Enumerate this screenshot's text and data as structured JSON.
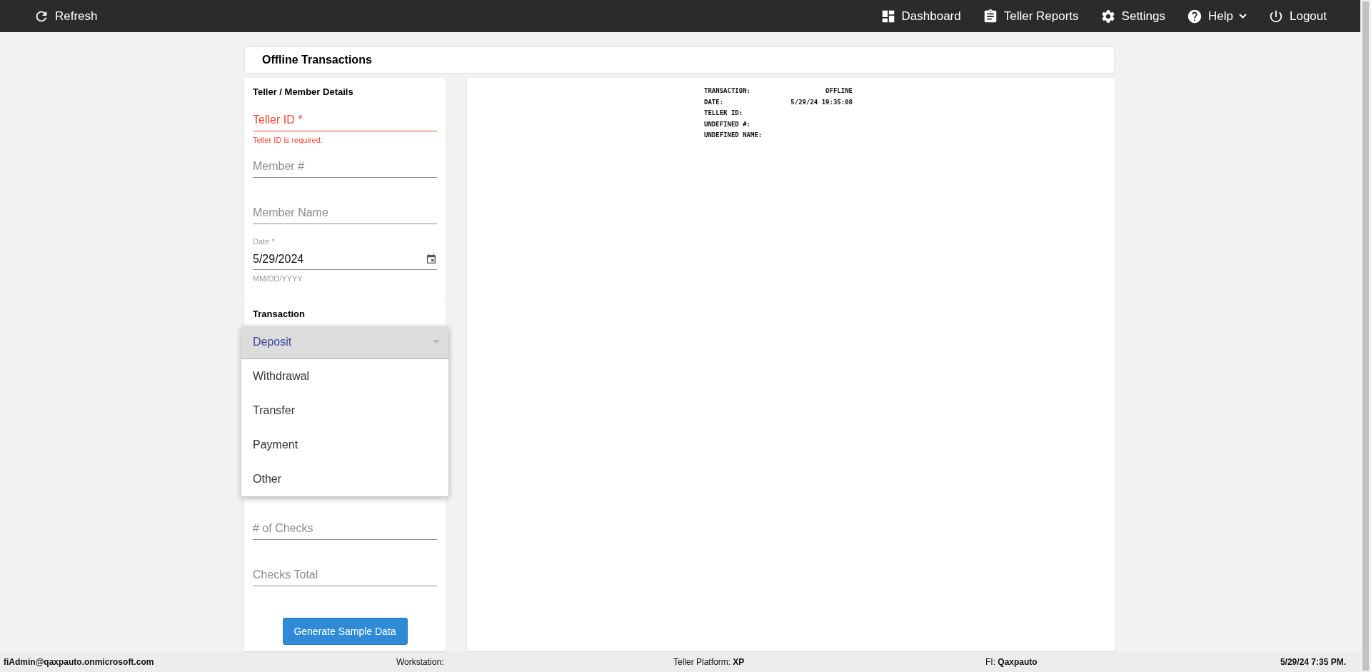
{
  "nav": {
    "left": [
      {
        "kind": "refresh",
        "label": "Refresh"
      }
    ],
    "right": [
      {
        "kind": "dashboard",
        "label": "Dashboard",
        "menu": false
      },
      {
        "kind": "clipboard",
        "label": "Teller Reports",
        "menu": false
      },
      {
        "kind": "gear",
        "label": "Settings",
        "menu": false
      },
      {
        "kind": "help",
        "label": "Help",
        "menu": true
      },
      {
        "kind": "power",
        "label": "Logout",
        "menu": false
      }
    ]
  },
  "page_title": "Offline Transactions",
  "details_card": {
    "title": "Teller / Member Details",
    "fields": [
      {
        "placeholder": "Teller ID *",
        "error": "Teller ID is required.",
        "invalid": true
      },
      {
        "placeholder": "Member #",
        "invalid": false
      },
      {
        "placeholder": "Member Name",
        "invalid": false
      }
    ],
    "date": {
      "label": "Date *",
      "value": "5/29/2024",
      "hint": "MM/DD/YYYY"
    }
  },
  "transaction_card": {
    "title": "Transaction",
    "type_menu": [
      {
        "label": "Deposit",
        "selected": true
      },
      {
        "label": "Withdrawal",
        "selected": false
      },
      {
        "label": "Transfer",
        "selected": false
      },
      {
        "label": "Payment",
        "selected": false
      },
      {
        "label": "Other",
        "selected": false
      }
    ],
    "fields": [
      {
        "placeholder": "# of Checks"
      },
      {
        "placeholder": "Checks Total"
      }
    ],
    "button": "Generate Sample Data"
  },
  "receipt": [
    {
      "label": "TRANSACTION:",
      "value": "OFFLINE"
    },
    {
      "label": "DATE:",
      "value": "5/29/24 19:35:08"
    },
    {
      "label": "TELLER ID:"
    },
    {
      "label": "UNDEFINED #:"
    },
    {
      "label": "UNDEFINED NAME:"
    }
  ],
  "status_bar": {
    "user": "fiAdmin@qaxpauto.onmicrosoft.com",
    "workstation": "Workstation:",
    "platform": "Teller Platform: **XP**",
    "fi": "FI: **Qaxpauto**",
    "time": "5/29/24 7:35 PM."
  }
}
